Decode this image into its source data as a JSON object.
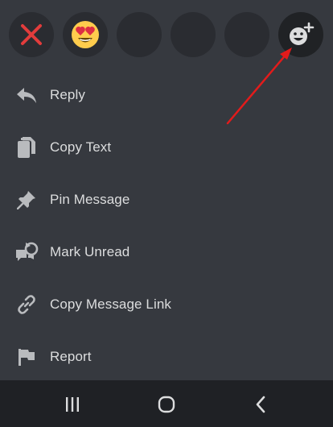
{
  "reactions": [
    {
      "icon": "close-icon",
      "color": "#e23c3c"
    },
    {
      "icon": "heart-eyes-emoji-icon"
    },
    {
      "icon": "empty-slot"
    },
    {
      "icon": "empty-slot"
    },
    {
      "icon": "empty-slot"
    },
    {
      "icon": "add-reaction-icon"
    }
  ],
  "menu": {
    "items": [
      {
        "label": "Reply",
        "icon": "reply-icon"
      },
      {
        "label": "Copy Text",
        "icon": "copy-icon"
      },
      {
        "label": "Pin Message",
        "icon": "pin-icon"
      },
      {
        "label": "Mark Unread",
        "icon": "mark-unread-icon"
      },
      {
        "label": "Copy Message Link",
        "icon": "link-icon"
      },
      {
        "label": "Report",
        "icon": "flag-icon"
      }
    ]
  },
  "nav": {
    "buttons": [
      "recent-apps-icon",
      "home-icon",
      "back-icon"
    ]
  },
  "colors": {
    "background": "#36393f",
    "nav_background": "#1f2125",
    "annotation_arrow": "#e31b1b",
    "icon": "#b9bbbe"
  }
}
